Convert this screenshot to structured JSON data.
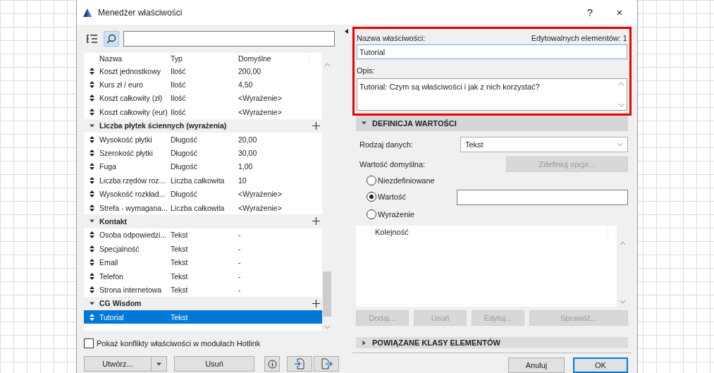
{
  "window": {
    "title": "Menedżer właściwości",
    "help": "?",
    "close": "×"
  },
  "table": {
    "columns": [
      "Nazwa",
      "Typ",
      "Domyślne"
    ],
    "rows": [
      {
        "kind": "item",
        "name": "Koszt jednostkowy",
        "type": "Ilość",
        "default": "200,00",
        "selected": false
      },
      {
        "kind": "item",
        "name": "Kurs zł / euro",
        "type": "Ilość",
        "default": "4,50",
        "selected": false
      },
      {
        "kind": "item",
        "name": "Koszt całkowity (zł)",
        "type": "Ilość",
        "default": "<Wyrażenie>",
        "selected": false
      },
      {
        "kind": "item",
        "name": "Koszt całkowity (eur)",
        "type": "Ilość",
        "default": "<Wyrażenie>",
        "selected": false
      },
      {
        "kind": "group",
        "name": "Liczba płytek ściennych (wyrażenia)",
        "expanded": true
      },
      {
        "kind": "item",
        "name": "Wysokość płytki",
        "type": "Długość",
        "default": "20,00",
        "selected": false
      },
      {
        "kind": "item",
        "name": "Szerokość płytki",
        "type": "Długość",
        "default": "30,00",
        "selected": false
      },
      {
        "kind": "item",
        "name": "Fuga",
        "type": "Długość",
        "default": "1,00",
        "selected": false
      },
      {
        "kind": "item",
        "name": "Liczba rzędów roz...",
        "type": "Liczba całkowita",
        "default": "10",
        "selected": false
      },
      {
        "kind": "item",
        "name": "Wysokość rozkład...",
        "type": "Długość",
        "default": "<Wyrażenie>",
        "selected": false
      },
      {
        "kind": "item",
        "name": "Strefa - wymagana...",
        "type": "Liczba całkowita",
        "default": "<Wyrażenie>",
        "selected": false
      },
      {
        "kind": "group",
        "name": "Kontakt",
        "expanded": true
      },
      {
        "kind": "item",
        "name": "Osoba odpowiedzi...",
        "type": "Tekst",
        "default": "-",
        "selected": false
      },
      {
        "kind": "item",
        "name": "Specjalność",
        "type": "Tekst",
        "default": "-",
        "selected": false
      },
      {
        "kind": "item",
        "name": "Email",
        "type": "Tekst",
        "default": "-",
        "selected": false
      },
      {
        "kind": "item",
        "name": "Telefon",
        "type": "Tekst",
        "default": "-",
        "selected": false
      },
      {
        "kind": "item",
        "name": "Strona internetowa",
        "type": "Tekst",
        "default": "-",
        "selected": false
      },
      {
        "kind": "group",
        "name": "CG Wisdom",
        "expanded": true
      },
      {
        "kind": "item",
        "name": "Tutorial",
        "type": "Tekst",
        "default": "",
        "selected": true
      }
    ]
  },
  "hotlink_checkbox": {
    "label": "Pokaż konflikty właściwości w modułach Hotlink",
    "checked": false
  },
  "left_buttons": {
    "create": "Utwórz...",
    "delete": "Usuń"
  },
  "property": {
    "name_label": "Nazwa właściwości:",
    "editable_count": "Edytowalnych elementów: 1",
    "name_value": "Tutorial",
    "description_label": "Opis:",
    "description_value": "Tutorial: Czym są właściwości i jak z nich korzystać?"
  },
  "value_definition": {
    "title": "DEFINICJA WARTOŚCI",
    "expanded": true,
    "data_type_label": "Rodzaj danych:",
    "data_type_value": "Tekst",
    "default_label": "Wartość domyślna:",
    "define_options": {
      "label": "Zdefiniuj opcje...",
      "disabled": true
    },
    "options": [
      {
        "label": "Niezdefiniowane",
        "selected": false
      },
      {
        "label": "Wartość",
        "selected": true
      },
      {
        "label": "Wyrażenie",
        "selected": false
      }
    ],
    "order_column": "Kolejność",
    "buttons": [
      {
        "label": "Dodaj...",
        "disabled": true
      },
      {
        "label": "Usuń",
        "disabled": true
      },
      {
        "label": "Edytuj...",
        "disabled": true
      },
      {
        "label": "Sprawdź...",
        "disabled": true
      }
    ]
  },
  "classes_section": {
    "title": "POWIĄZANE KLASY ELEMENTÓW",
    "expanded": false
  },
  "footer_buttons": [
    {
      "label": "Anuluj",
      "default": false
    },
    {
      "label": "OK",
      "default": true
    }
  ]
}
